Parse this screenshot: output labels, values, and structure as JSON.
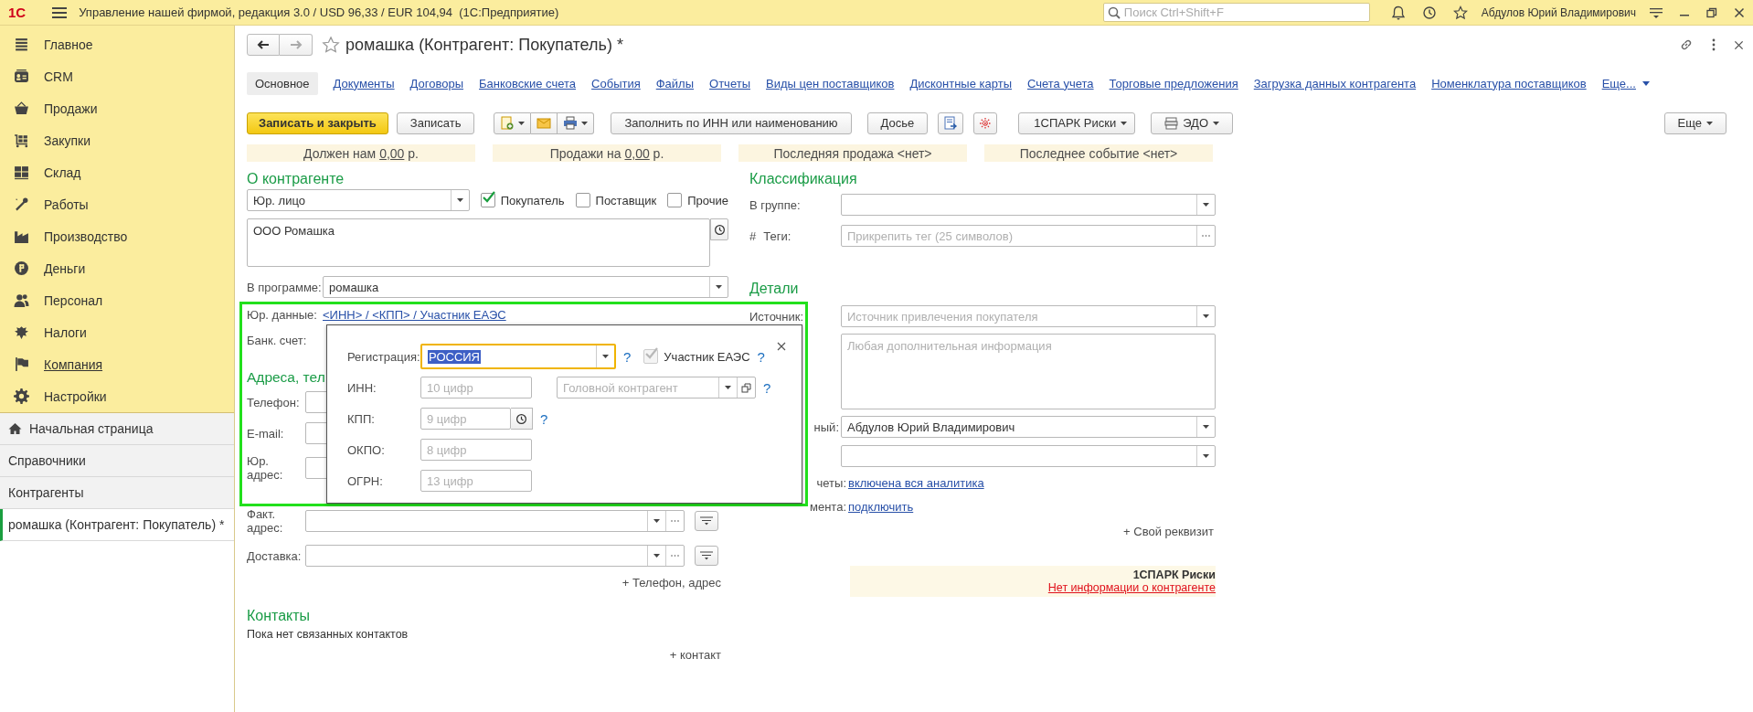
{
  "app_bar": {
    "logo": "1С",
    "title": "Управление нашей фирмой, редакция 3.0 / USD 96,33 / EUR 104,94  (1С:Предприятие)",
    "search": {
      "placeholder": "Поиск Ctrl+Shift+F"
    },
    "user": "Абдулов Юрий Владимирович"
  },
  "sidebar": {
    "sections": [
      {
        "label": "Главное",
        "hovered": false
      },
      {
        "label": "CRM",
        "hovered": false
      },
      {
        "label": "Продажи",
        "hovered": false
      },
      {
        "label": "Закупки",
        "hovered": false
      },
      {
        "label": "Склад",
        "hovered": false
      },
      {
        "label": "Работы",
        "hovered": false
      },
      {
        "label": "Производство",
        "hovered": false
      },
      {
        "label": "Деньги",
        "hovered": false
      },
      {
        "label": "Персонал",
        "hovered": false
      },
      {
        "label": "Налоги",
        "hovered": false
      },
      {
        "label": "Компания",
        "hovered": true
      },
      {
        "label": "Настройки",
        "hovered": false
      }
    ],
    "open_windows": [
      {
        "label": "Начальная страница",
        "selected": false
      },
      {
        "label": "Справочники",
        "selected": false
      },
      {
        "label": "Контрагенты",
        "selected": false
      },
      {
        "label": "ромашка (Контрагент: Покупатель) *",
        "selected": true
      }
    ]
  },
  "form": {
    "title": "ромашка (Контрагент: Покупатель) *",
    "tabs": [
      {
        "label": "Основное",
        "selected": true
      },
      {
        "label": "Документы",
        "selected": false
      },
      {
        "label": "Договоры",
        "selected": false
      },
      {
        "label": "Банковские счета",
        "selected": false
      },
      {
        "label": "События",
        "selected": false
      },
      {
        "label": "Файлы",
        "selected": false
      },
      {
        "label": "Отчеты",
        "selected": false
      },
      {
        "label": "Виды цен поставщиков",
        "selected": false
      },
      {
        "label": "Дисконтные карты",
        "selected": false
      },
      {
        "label": "Счета учета",
        "selected": false
      },
      {
        "label": "Торговые предложения",
        "selected": false
      },
      {
        "label": "Загрузка данных контрагента",
        "selected": false
      },
      {
        "label": "Номенклатура поставщиков",
        "selected": false
      }
    ],
    "more_tabs": "Еще...",
    "toolbar": {
      "save_close": "Записать и закрыть",
      "save": "Записать",
      "fill": "Заполнить по ИНН или наименованию",
      "dossier": "Досье",
      "spark": "1СПАРК Риски",
      "edo": "ЭДО",
      "more": "Еще"
    },
    "summary": [
      {
        "prefix": "Должен нам ",
        "amount": "0,00",
        "suffix": " р."
      },
      {
        "prefix": "Продажи на ",
        "amount": "0,00",
        "suffix": " р."
      },
      {
        "prefix": "Последняя продажа <нет>"
      },
      {
        "prefix": "Последнее событие <нет>"
      }
    ]
  },
  "about": {
    "heading": "О контрагенте",
    "type_value": "Юр. лицо",
    "roles": [
      {
        "label": "Покупатель",
        "checked": true
      },
      {
        "label": "Поставщик",
        "checked": false
      },
      {
        "label": "Прочие",
        "checked": false
      }
    ],
    "full_name": "ООО Ромашка",
    "program_label": "В программе:",
    "program_value": "ромашка",
    "legal_label": "Юр. данные:",
    "legal_link": "<ИНН> / <КПП> / Участник ЕАЭС",
    "bank_label": "Банк. счет:"
  },
  "addresses": {
    "heading": "Адреса, тел",
    "rows": [
      {
        "label": "Телефон:"
      },
      {
        "label": "E-mail:"
      },
      {
        "label": "Юр. адрес:"
      },
      {
        "label": "Факт. адрес:"
      },
      {
        "label": "Доставка:"
      }
    ],
    "add": "+ Телефон, адрес"
  },
  "contacts": {
    "heading": "Контакты",
    "empty": "Пока нет связанных контактов",
    "add": "+ контакт"
  },
  "classification": {
    "heading": "Классификация",
    "group_label": "В группе:",
    "tags_mark": "#",
    "tags_label": "Теги:",
    "tags_placeholder": "Прикрепить тег (25 символов)"
  },
  "details": {
    "heading": "Детали",
    "rows": [
      {
        "kind": "select",
        "label": "Источник:",
        "placeholder": "Источник привлечения покупателя"
      },
      {
        "kind": "textarea",
        "placeholder": "Любая дополнительная информация"
      },
      {
        "kind": "select",
        "label": "ный:",
        "value": "Абдулов Юрий Владимирович"
      },
      {
        "kind": "select"
      },
      {
        "kind": "link",
        "label": "четы:",
        "link": "включена вся аналитика"
      },
      {
        "kind": "link",
        "label": "мента:",
        "link": "подключить"
      }
    ],
    "add": "+ Свой реквизит"
  },
  "spark": {
    "title": "1СПАРК Риски",
    "link": "Нет информации о контрагенте"
  },
  "legal_popup": {
    "registration": {
      "label": "Регистрация:",
      "value": "РОССИЯ",
      "focused": true,
      "help": "?"
    },
    "eaeu": {
      "label": "Участник ЕАЭС",
      "checked": true,
      "disabled": true,
      "help": "?"
    },
    "rows": [
      {
        "label": "ИНН:",
        "placeholder": "10 цифр",
        "head": {
          "placeholder": "Головной контрагент",
          "help": "?"
        }
      },
      {
        "label": "КПП:",
        "placeholder": "9 цифр",
        "history": true,
        "help": "?"
      },
      {
        "label": "ОКПО:",
        "placeholder": "8 цифр"
      },
      {
        "label": "ОГРН:",
        "placeholder": "13 цифр"
      }
    ]
  }
}
